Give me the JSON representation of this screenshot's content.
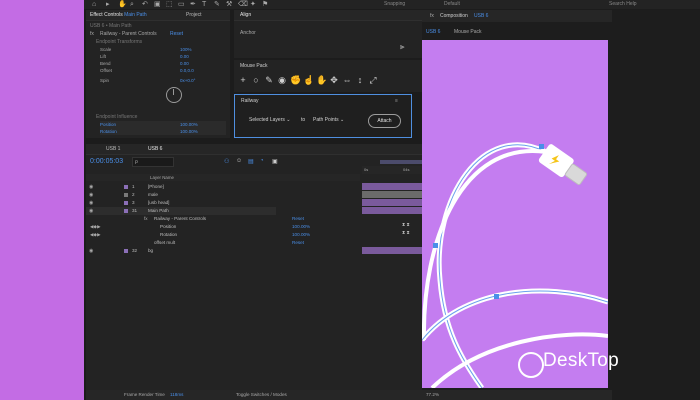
{
  "topbar": {
    "snapping_label": "Snapping",
    "workspace_label": "Default",
    "help_search_placeholder": "Search Help",
    "tools": [
      "▸",
      "✋",
      "🔍",
      "↶",
      "⬚",
      "✎",
      "T",
      "✐",
      "⌫",
      "✦",
      "⚑"
    ]
  },
  "effect_controls": {
    "tab": "Effect Controls",
    "tab_suffix": "Main Path",
    "project_tab": "Project",
    "breadcrumb": "USB 6 • Main Path",
    "fx_name": "Railway - Parent Controls",
    "reset_label": "Reset",
    "group_label": "Endpoint Transforms",
    "rows": [
      {
        "label": "Scale",
        "value": "100%"
      },
      {
        "label": "Lift",
        "value": "0.00"
      },
      {
        "label": "Bend",
        "value": "0.00"
      },
      {
        "label": "Offset",
        "value": "0.0,0.0"
      },
      {
        "label": "Spin",
        "value": "0x+0.0°"
      }
    ],
    "group2_label": "Endpoint Influence",
    "rows2": [
      {
        "label": "Position",
        "value": "100.00%"
      },
      {
        "label": "Rotation",
        "value": "100.00%"
      }
    ]
  },
  "align": {
    "tab": "Align",
    "anchor_label": "Anchor"
  },
  "mouse_pack": {
    "title": "Mouse Pack",
    "icons": [
      "+",
      "○",
      "✎",
      "◉",
      "✋",
      "☝",
      "✋",
      "✥",
      "⇔",
      "↕",
      "↗"
    ]
  },
  "railway": {
    "title": "Railway",
    "select1": "Selected Layers",
    "to_label": "to",
    "select2": "Path Points",
    "attach_button": "Attach"
  },
  "timeline": {
    "tab1": "USB 1",
    "tab2": "USB 6",
    "timecode": "0:00:05:03",
    "search_placeholder": "ρ",
    "column_header": "Layer Name",
    "layers": [
      {
        "num": "1",
        "name": "[Phone]",
        "color": "#8b6fb7"
      },
      {
        "num": "2",
        "name": "male",
        "color": "#7a7a7a"
      },
      {
        "num": "3",
        "name": "[usb head]",
        "color": "#8b6fb7"
      },
      {
        "num": "31",
        "name": "Main Path",
        "color": "#8b6fb7"
      }
    ],
    "sub_rows": [
      {
        "label": "Railway - Parent Controls",
        "value": "Reset"
      },
      {
        "label": "Position",
        "value": "100.00%"
      },
      {
        "label": "Rotation",
        "value": "100.00%"
      },
      {
        "label": "offset mult",
        "value": "Reset"
      }
    ],
    "last_layer": {
      "num": "32",
      "name": "bg"
    },
    "ruler_labels": [
      "0s",
      "04s",
      "08s",
      "12s",
      "16s",
      "20s"
    ],
    "bottom_label": "Frame Render Time",
    "bottom_value": "118ms",
    "toggle_label": "Toggle Switches / Modes"
  },
  "composition": {
    "tab": "Composition",
    "tab_suffix": "USB 6",
    "sub_tabs": [
      "USB 6",
      "Mouse Pack"
    ],
    "zoom": "77.2%",
    "accent": "#4a8fe8",
    "bg_color": "#c47df0"
  },
  "watermark": "DeskTop"
}
